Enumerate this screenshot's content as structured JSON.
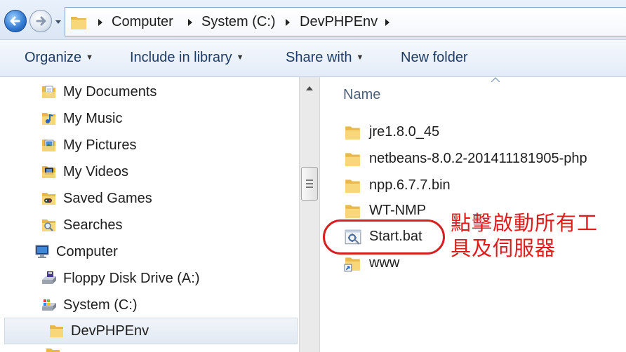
{
  "address_bar": {
    "crumbs": [
      "Computer",
      "System (C:)",
      "DevPHPEnv"
    ]
  },
  "toolbar": {
    "organize_label": "Organize",
    "include_label": "Include in library",
    "share_label": "Share with",
    "new_folder_label": "New folder"
  },
  "nav_pane": {
    "items": [
      {
        "label": "My Documents",
        "icon": "documents-folder-icon"
      },
      {
        "label": "My Music",
        "icon": "music-folder-icon"
      },
      {
        "label": "My Pictures",
        "icon": "pictures-folder-icon"
      },
      {
        "label": "My Videos",
        "icon": "videos-folder-icon"
      },
      {
        "label": "Saved Games",
        "icon": "saved-games-icon"
      },
      {
        "label": "Searches",
        "icon": "searches-icon"
      },
      {
        "label": "Computer",
        "icon": "computer-icon"
      },
      {
        "label": "Floppy Disk Drive (A:)",
        "icon": "floppy-drive-icon"
      },
      {
        "label": "System (C:)",
        "icon": "hard-drive-icon"
      },
      {
        "label": "DevPHPEnv",
        "icon": "folder-icon",
        "selected": true
      }
    ]
  },
  "content": {
    "column_header": "Name",
    "files": [
      {
        "label": "jre1.8.0_45",
        "icon": "folder-icon"
      },
      {
        "label": "netbeans-8.0.2-201411181905-php",
        "icon": "folder-icon"
      },
      {
        "label": "npp.6.7.7.bin",
        "icon": "folder-icon"
      },
      {
        "label": "WT-NMP",
        "icon": "folder-icon"
      },
      {
        "label": "Start.bat",
        "icon": "batch-file-icon"
      },
      {
        "label": "www",
        "icon": "shortcut-folder-icon"
      }
    ]
  },
  "annotation": {
    "text": "點擊啟動所有工具及伺服器",
    "color": "#e01b1b"
  },
  "colors": {
    "toolbar_text": "#1e3c64",
    "header_text": "#4c607a",
    "annotation_red": "#d62020"
  }
}
